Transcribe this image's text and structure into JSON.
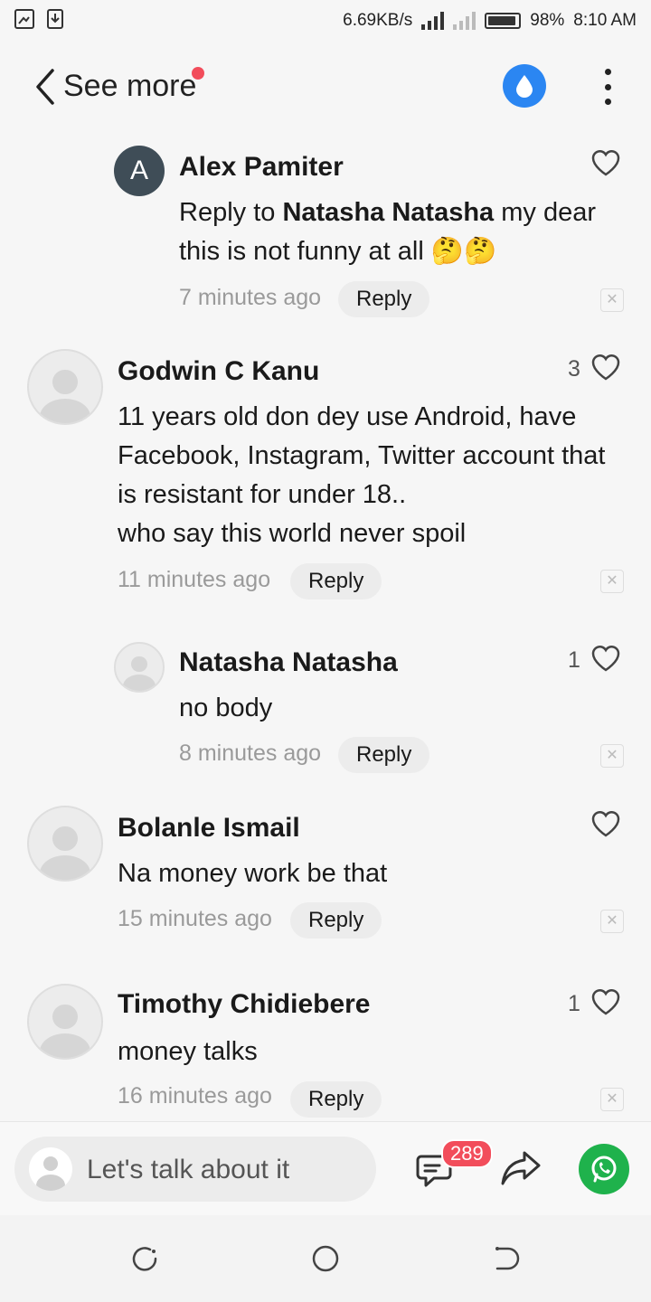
{
  "status_bar": {
    "speed": "6.69KB/s",
    "battery": "98%",
    "time": "8:10 AM"
  },
  "header": {
    "back_label": "See more"
  },
  "comments": [
    {
      "avatar_letter": "A",
      "name": "Alex Pamiter",
      "text_prefix": "Reply to ",
      "text_mention": "Natasha Natasha",
      "text_line1_rest": " my dear",
      "text_line2": "this is not funny at all 🤔🤔",
      "time": "7 minutes ago",
      "reply_label": "Reply",
      "likes": ""
    },
    {
      "name": "Godwin C Kanu",
      "lines": [
        "11 years old don dey use Android, have",
        "Facebook, Instagram, Twitter account that",
        "is resistant for under 18..",
        "who say this world never spoil"
      ],
      "time": "11 minutes ago",
      "reply_label": "Reply",
      "likes": "3"
    },
    {
      "name": "Natasha Natasha",
      "text": "no body",
      "time": "8 minutes ago",
      "reply_label": "Reply",
      "likes": "1"
    },
    {
      "name": "Bolanle Ismail",
      "text": "Na money work be that",
      "time": "15 minutes ago",
      "reply_label": "Reply",
      "likes": ""
    },
    {
      "name": "Timothy Chidiebere",
      "text": "money talks",
      "time": "16 minutes ago",
      "reply_label": "Reply",
      "likes": "1"
    }
  ],
  "bottom_bar": {
    "input_placeholder": "Let's talk about it",
    "comment_count": "289"
  },
  "colors": {
    "accent_blue": "#2b86f2",
    "badge_red": "#f24d5b",
    "whatsapp_green": "#1fb24c"
  },
  "icons": [
    "gallery-icon",
    "download-icon",
    "droplet-icon",
    "more-icon",
    "heart-icon",
    "close-icon",
    "comment-icon",
    "share-icon",
    "whatsapp-icon",
    "recent-apps-icon",
    "home-icon",
    "back-nav-icon"
  ]
}
